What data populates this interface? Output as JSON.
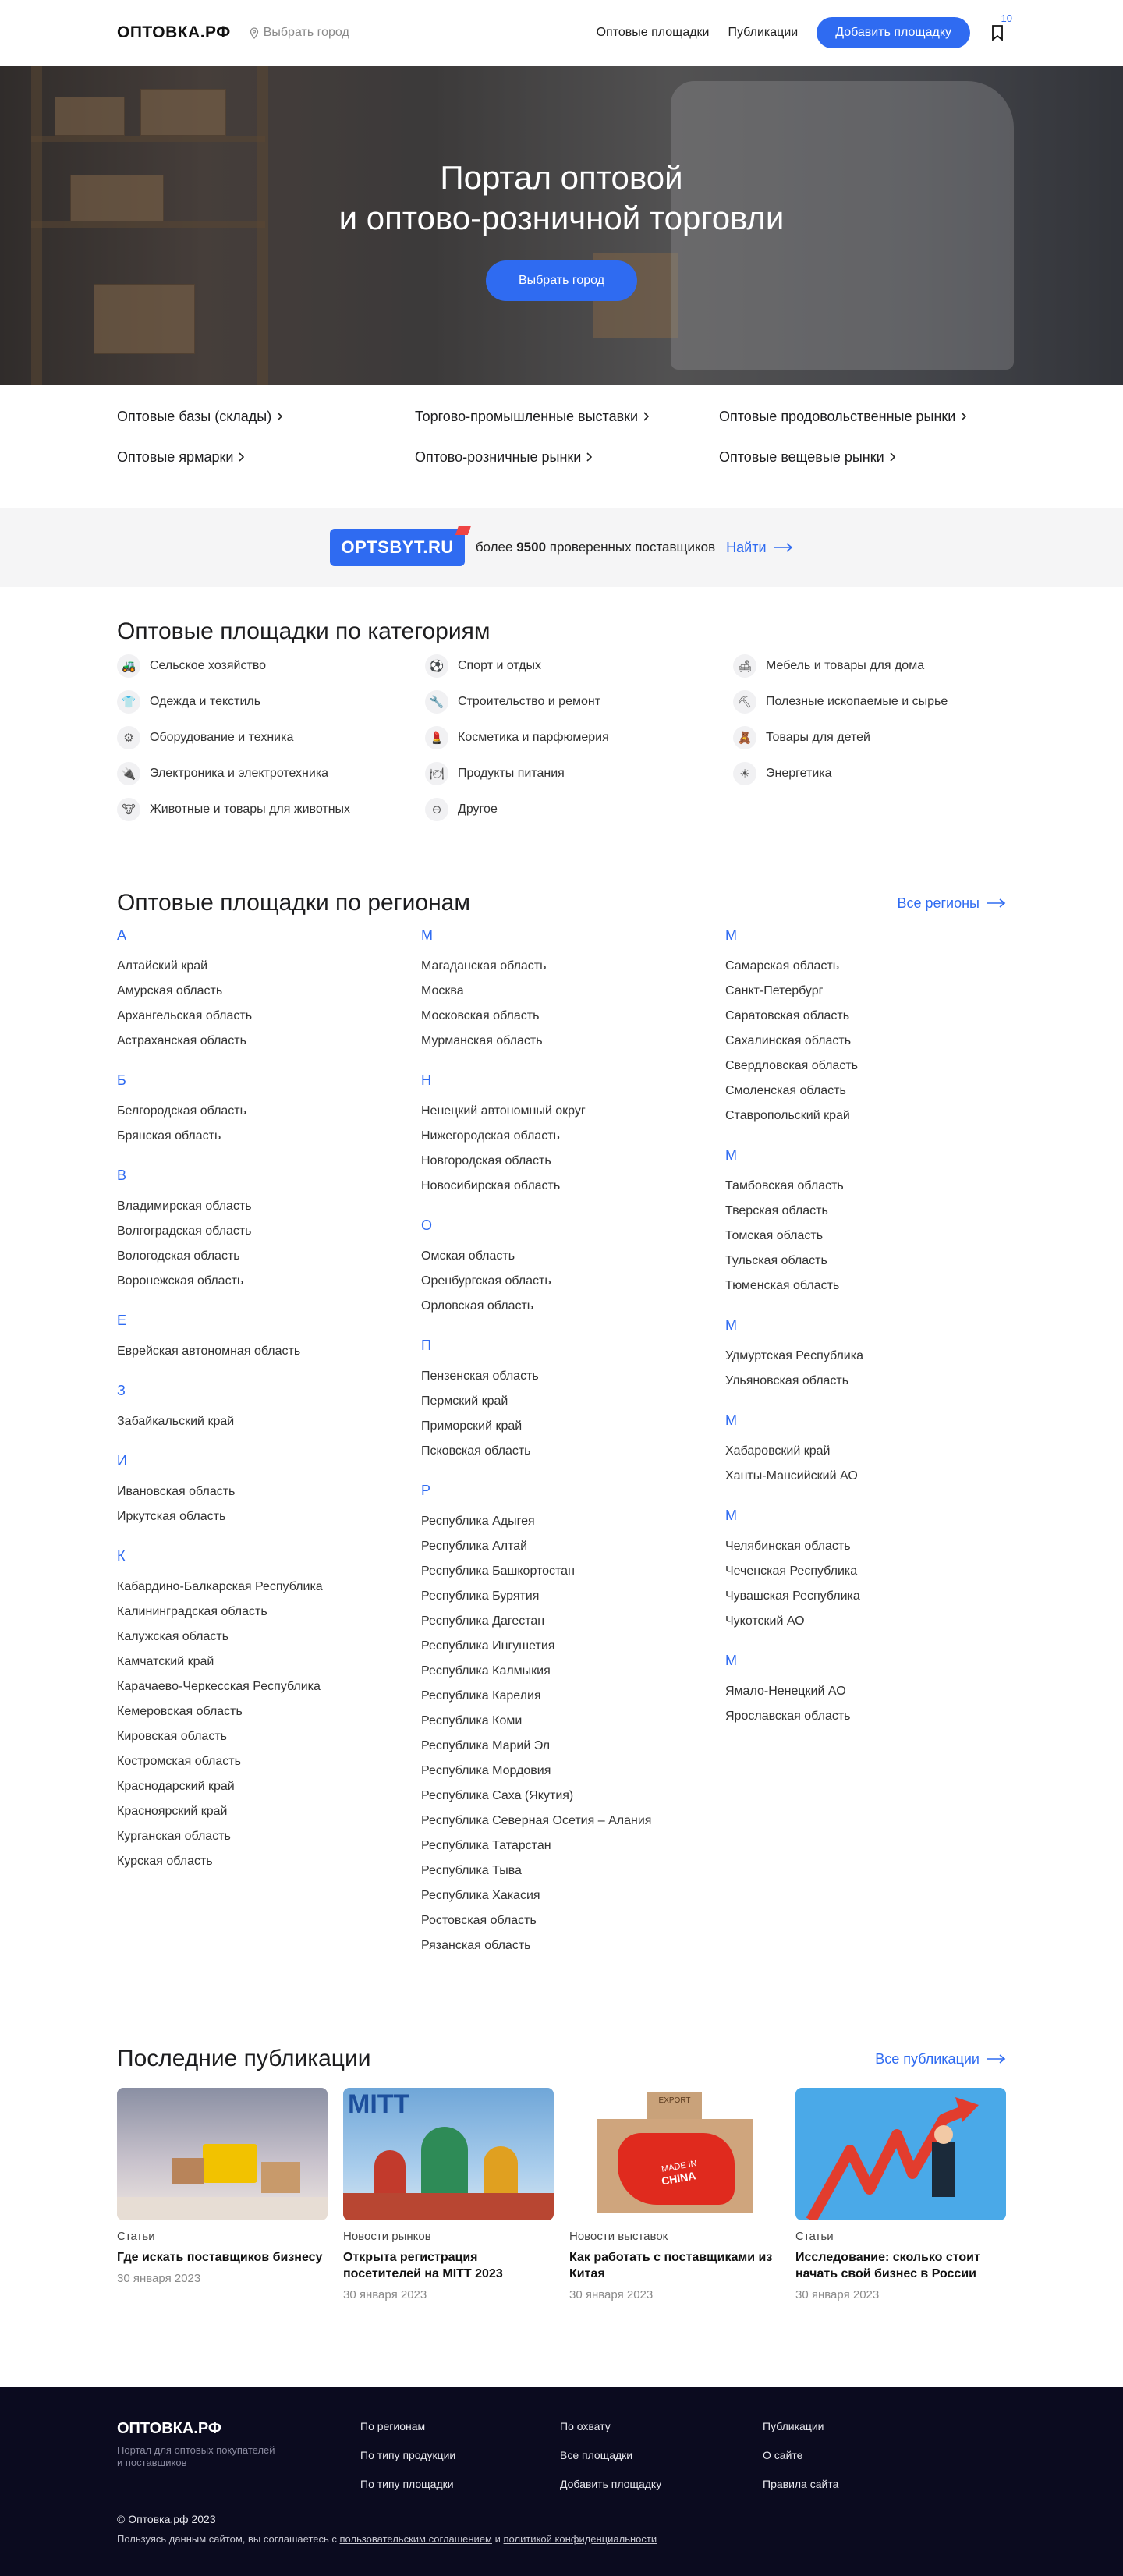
{
  "header": {
    "logo": "ОПТОВКА.РФ",
    "city_placeholder": "Выбрать город",
    "nav": [
      "Оптовые площадки",
      "Публикации"
    ],
    "add_button": "Добавить площадку",
    "bookmark_count": "10"
  },
  "hero": {
    "title_line1": "Портал оптовой",
    "title_line2": "и оптово-розничной торговли",
    "button": "Выбрать город"
  },
  "quick_links": [
    "Оптовые базы (склады)",
    "Торгово-промышленные выставки",
    "Оптовые продовольственные рынки",
    "Оптовые ярмарки",
    "Оптово-розничные рынки",
    "Оптовые вещевые рынки"
  ],
  "banner": {
    "logo": "OPTSBYT.RU",
    "text_before": "более",
    "count": "9500",
    "text_after": "проверенных поставщиков",
    "link": "Найти"
  },
  "categories": {
    "title": "Оптовые площадки по категориям",
    "items": [
      {
        "label": "Сельское хозяйство",
        "icon": "tractor-icon",
        "glyph": "🚜"
      },
      {
        "label": "Спорт и отдых",
        "icon": "sport-icon",
        "glyph": "⚽"
      },
      {
        "label": "Мебель и товары для дома",
        "icon": "sofa-icon",
        "glyph": "🛋"
      },
      {
        "label": "Одежда и текстиль",
        "icon": "shirt-icon",
        "glyph": "👕"
      },
      {
        "label": "Строительство и ремонт",
        "icon": "tools-icon",
        "glyph": "🔧"
      },
      {
        "label": "Полезные ископаемые и сырье",
        "icon": "minecart-icon",
        "glyph": "⛏"
      },
      {
        "label": "Оборудование и техника",
        "icon": "gear-icon",
        "glyph": "⚙"
      },
      {
        "label": "Косметика и парфюмерия",
        "icon": "perfume-icon",
        "glyph": "💄"
      },
      {
        "label": "Товары для детей",
        "icon": "pacifier-icon",
        "glyph": "🧸"
      },
      {
        "label": "Электроника и электротехника",
        "icon": "chip-icon",
        "glyph": "🔌"
      },
      {
        "label": "Продукты питания",
        "icon": "food-icon",
        "glyph": "🍽"
      },
      {
        "label": "Энергетика",
        "icon": "energy-icon",
        "glyph": "☀"
      },
      {
        "label": "Животные и товары для животных",
        "icon": "animal-icon",
        "glyph": "🐮"
      },
      {
        "label": "Другое",
        "icon": "other-icon",
        "glyph": "⊖"
      }
    ]
  },
  "regions": {
    "title": "Оптовые площадки по регионам",
    "all_link": "Все регионы",
    "columns": [
      [
        {
          "letter": "А",
          "items": [
            "Алтайский край",
            "Амурская область",
            "Архангельская область",
            "Астраханская область"
          ]
        },
        {
          "letter": "Б",
          "items": [
            "Белгородская область",
            "Брянская область"
          ]
        },
        {
          "letter": "В",
          "items": [
            "Владимирская область",
            "Волгоградская область",
            "Вологодская область",
            "Воронежская область"
          ]
        },
        {
          "letter": "Е",
          "items": [
            "Еврейская автономная область"
          ]
        },
        {
          "letter": "З",
          "items": [
            "Забайкальский край"
          ]
        },
        {
          "letter": "И",
          "items": [
            "Ивановская область",
            "Иркутская область"
          ]
        },
        {
          "letter": "К",
          "items": [
            "Кабардино-Балкарская Республика",
            "Калининградская область",
            "Калужская область",
            "Камчатский край",
            "Карачаево-Черкесская Республика",
            "Кемеровская область",
            "Кировская область",
            "Костромская область",
            "Краснодарский край",
            "Красноярский край",
            "Курганская область",
            "Курская область"
          ]
        }
      ],
      [
        {
          "letter": "М",
          "items": [
            "Магаданская область",
            "Москва",
            "Московская область",
            "Мурманская область"
          ]
        },
        {
          "letter": "Н",
          "items": [
            "Ненецкий автономный округ",
            "Нижегородская область",
            "Новгородская область",
            "Новосибирская область"
          ]
        },
        {
          "letter": "О",
          "items": [
            "Омская область",
            "Оренбургская область",
            "Орловская область"
          ]
        },
        {
          "letter": "П",
          "items": [
            "Пензенская область",
            "Пермский край",
            "Приморский край",
            "Псковская область"
          ]
        },
        {
          "letter": "Р",
          "items": [
            "Республика Адыгея",
            "Республика Алтай",
            "Республика Башкортостан",
            "Республика Бурятия",
            "Республика Дагестан",
            "Республика Ингушетия",
            "Республика Калмыкия",
            "Республика Карелия",
            "Республика Коми",
            "Республика Марий Эл",
            "Республика Мордовия",
            "Республика Саха (Якутия)",
            "Республика Северная Осетия – Алания",
            "Республика Татарстан",
            "Республика Тыва",
            "Республика Хакасия",
            "Ростовская область",
            "Рязанская область"
          ]
        }
      ],
      [
        {
          "letter": "М",
          "items": [
            "Самарская область",
            "Санкт-Петербург",
            "Саратовская область",
            "Сахалинская область",
            "Свердловская область",
            "Смоленская область",
            "Ставропольский край"
          ]
        },
        {
          "letter": "М",
          "items": [
            "Тамбовская область",
            "Тверская область",
            "Томская область",
            "Тульская область",
            "Тюменская область"
          ]
        },
        {
          "letter": "М",
          "items": [
            "Удмуртская Республика",
            "Ульяновская область"
          ]
        },
        {
          "letter": "М",
          "items": [
            "Хабаровский край",
            "Ханты-Мансийский АО"
          ]
        },
        {
          "letter": "М",
          "items": [
            "Челябинская область",
            "Чеченская Республика",
            "Чувашская Республика",
            "Чукотский АО"
          ]
        },
        {
          "letter": "М",
          "items": [
            "Ямало-Ненецкий АО",
            "Ярославская область"
          ]
        }
      ]
    ]
  },
  "publications": {
    "title": "Последние публикации",
    "all_link": "Все публикации",
    "items": [
      {
        "category": "Статьи",
        "title": "Где искать поставщиков бизнесу",
        "date": "30 января 2023"
      },
      {
        "category": "Новости рынков",
        "title": "Открыта регистрация посетителей на MITT 2023",
        "date": "30 января 2023"
      },
      {
        "category": "Новости выставок",
        "title": "Как работать с поставщиками из Китая",
        "date": "30 января 2023"
      },
      {
        "category": "Статьи",
        "title": "Исследование: сколько стоит начать свой бизнес в России",
        "date": "30 января 2023"
      }
    ],
    "image_texts": {
      "mitt": "MITT",
      "export": "EXPORT",
      "made_in": "MADE IN",
      "china": "CHINA"
    }
  },
  "footer": {
    "logo": "ОПТОВКА.РФ",
    "desc": "Портал для оптовых покупателей и поставщиков",
    "col1": [
      "По регионам",
      "По типу продукции",
      "По типу площадки"
    ],
    "col2": [
      "По охвату",
      "Все площадки",
      "Добавить площадку"
    ],
    "col3": [
      "Публикации",
      "О сайте",
      "Правила сайта"
    ],
    "copyright": "© Оптовка.рф 2023",
    "note_before": "Пользуясь данным сайтом, вы соглашаетесь с",
    "note_link1": "пользовательским соглашением",
    "note_and": "и",
    "note_link2": "политикой конфиденциальности"
  },
  "colors": {
    "accent": "#2f6bf1",
    "footer_bg": "#0b0b1f",
    "banner_bg": "#f5f5f6"
  }
}
